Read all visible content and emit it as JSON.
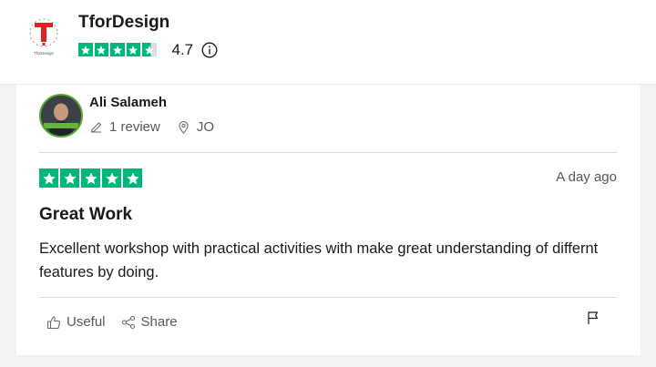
{
  "business": {
    "name": "TforDesign",
    "logo_text": "T",
    "logo_subtext": "TforDesign",
    "rating": "4.7",
    "stars_filled": 4.6,
    "brand_color": "#e31e24"
  },
  "review": {
    "reviewer_name": "Ali Salameh",
    "review_count": "1 review",
    "country": "JO",
    "stars": 5,
    "date": "A day ago",
    "title": "Great Work",
    "text": "Excellent workshop with practical activities with make great understanding of differnt features by doing.",
    "actions": {
      "useful_label": "Useful",
      "share_label": "Share"
    }
  },
  "colors": {
    "star_green": "#00b67a",
    "star_empty": "#dcdce6",
    "avatar_ring": "#5aa832"
  },
  "icons": [
    "info-icon",
    "pencil-icon",
    "location-pin-icon",
    "thumbs-up-icon",
    "share-icon",
    "flag-icon",
    "star-icon"
  ]
}
